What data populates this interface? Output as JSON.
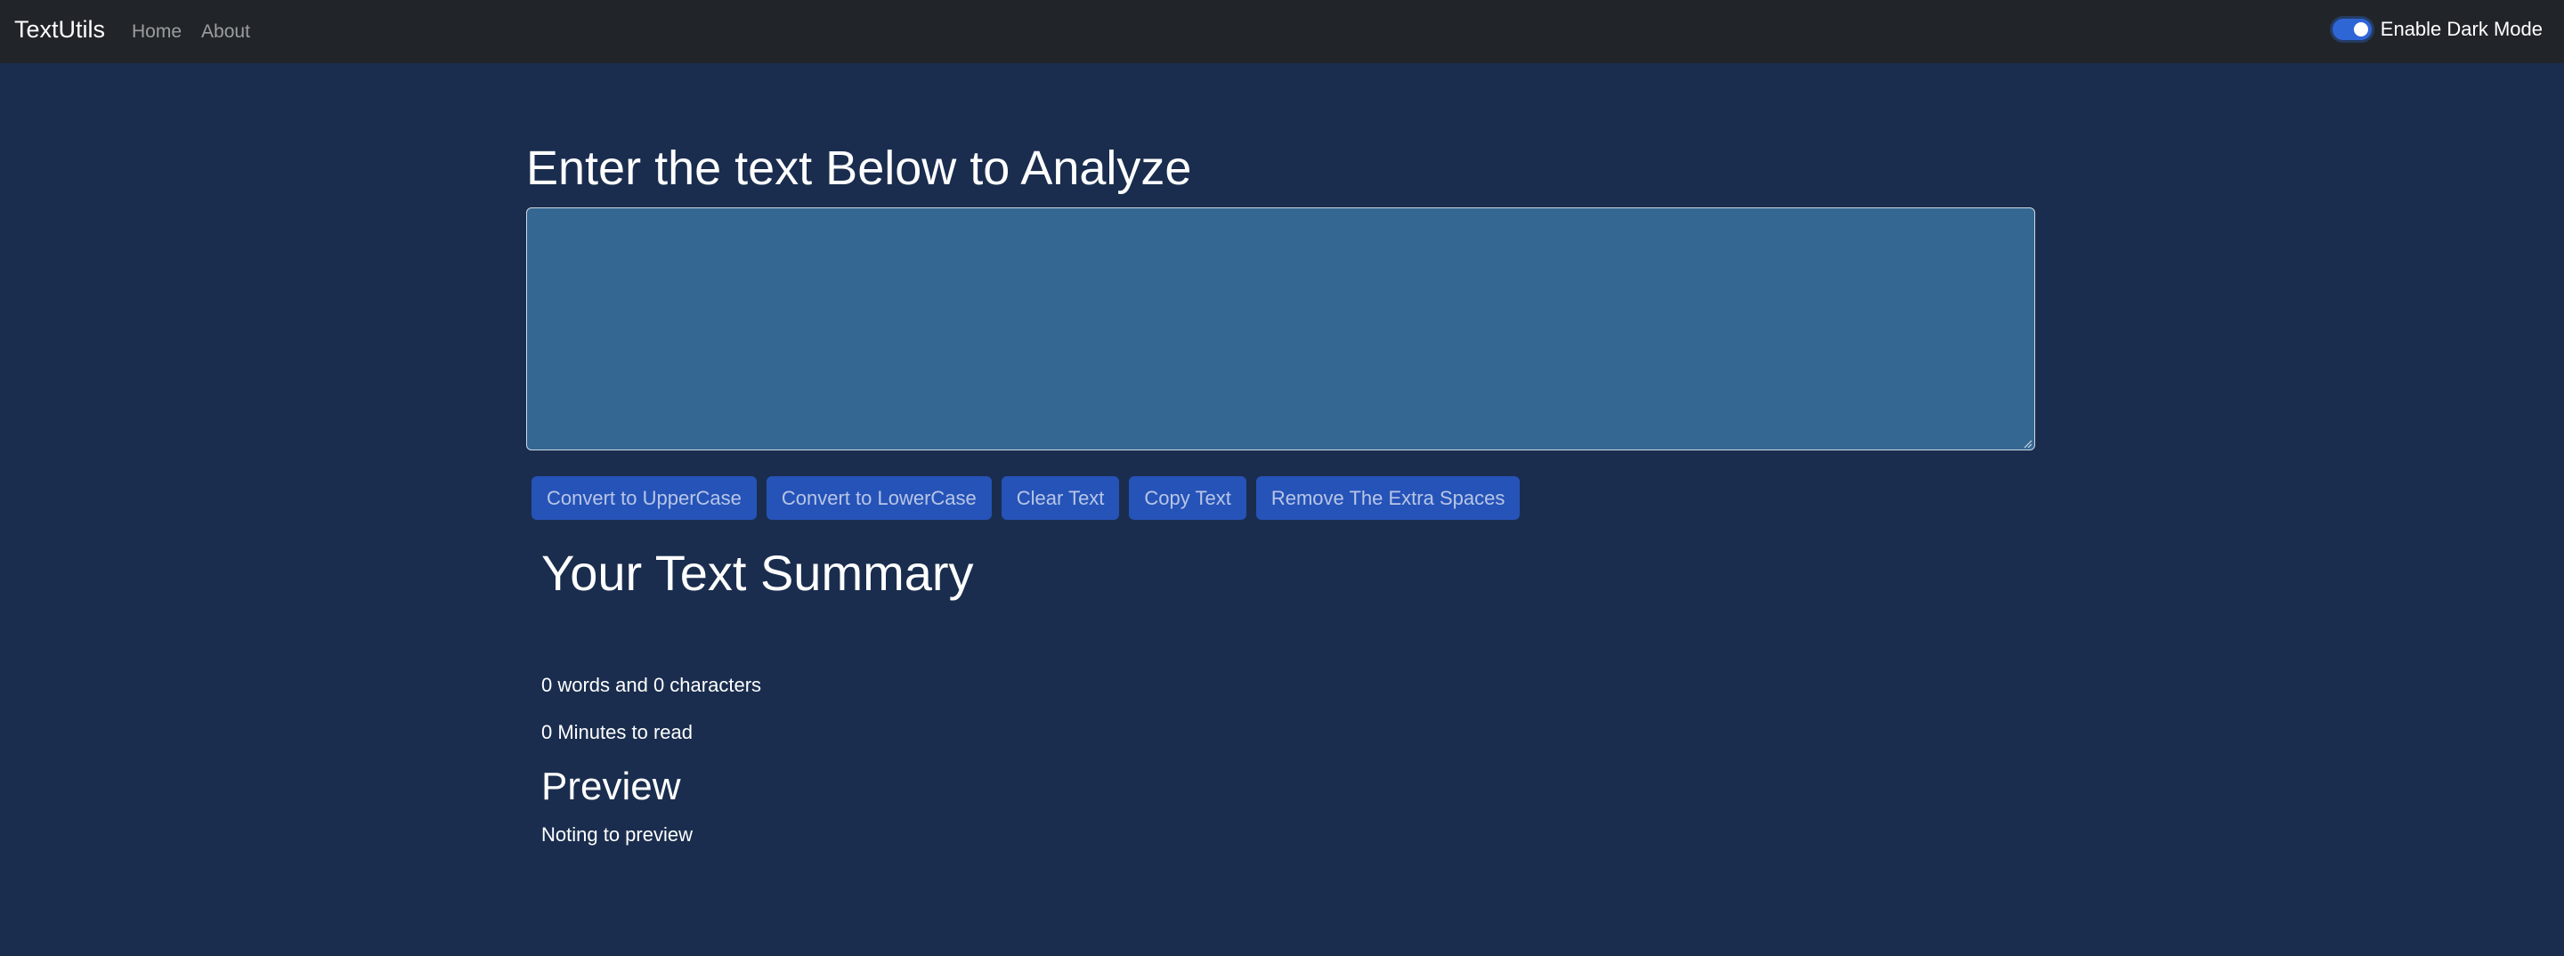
{
  "navbar": {
    "brand": "TextUtils",
    "links": [
      "Home",
      "About"
    ],
    "dark_mode_label": "Enable Dark Mode",
    "dark_mode_enabled": true
  },
  "main": {
    "heading": "Enter the text Below to Analyze",
    "textarea": {
      "value": "",
      "placeholder": ""
    },
    "buttons": {
      "uppercase": "Convert to UpperCase",
      "lowercase": "Convert to LowerCase",
      "clear": "Clear Text",
      "copy": "Copy Text",
      "remove_spaces": "Remove The Extra Spaces"
    }
  },
  "summary": {
    "title": "Your Text Summary",
    "counts": "0 words and 0 characters",
    "read_time": "0 Minutes to read",
    "preview_title": "Preview",
    "preview_text": "Noting to preview"
  },
  "colors": {
    "page_background": "#1a2d4e",
    "navbar_background": "#212529",
    "textarea_background": "#346792",
    "button_background": "#2653b8",
    "accent": "#2f66d6"
  }
}
